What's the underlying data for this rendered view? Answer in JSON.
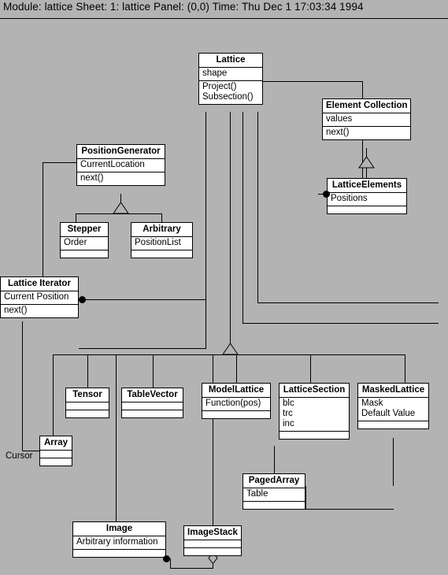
{
  "header": {
    "text": "Module: lattice  Sheet: 1: lattice  Panel: (0,0)  Time: Thu Dec  1 17:03:34 1994",
    "module_label": "Module:",
    "module_value": "lattice",
    "sheet_label": "Sheet:",
    "sheet_value": "1: lattice",
    "panel_label": "Panel:",
    "panel_value": "(0,0)",
    "time_label": "Time:",
    "time_value": "Thu Dec  1 17:03:34 1994"
  },
  "colors": {
    "background": "#b3b3b3",
    "box_fill": "#ffffff",
    "line": "#000000",
    "text": "#000000"
  },
  "classes": {
    "lattice": {
      "name": "Lattice",
      "attributes": "shape",
      "operations": "Project()\nSubsection()"
    },
    "element_collection": {
      "name": "Element Collection",
      "attributes": "values",
      "operations": "next()"
    },
    "lattice_elements": {
      "name": "LatticeElements",
      "attributes": "Positions",
      "operations": ""
    },
    "position_generator": {
      "name": "PositionGenerator",
      "attributes": "CurrentLocation",
      "operations": "next()"
    },
    "stepper": {
      "name": "Stepper",
      "attributes": "Order",
      "operations": ""
    },
    "arbitrary": {
      "name": "Arbitrary",
      "attributes": "PositionList",
      "operations": ""
    },
    "lattice_iterator": {
      "name": "Lattice Iterator",
      "attributes": "Current Position",
      "operations": "next()"
    },
    "tensor": {
      "name": "Tensor",
      "attributes": "",
      "operations": ""
    },
    "table_vector": {
      "name": "TableVector",
      "attributes": "",
      "operations": ""
    },
    "model_lattice": {
      "name": "ModelLattice",
      "attributes": "Function(pos)",
      "operations": ""
    },
    "lattice_section": {
      "name": "LatticeSection",
      "attributes": "blc\ntrc\ninc",
      "operations": ""
    },
    "masked_lattice": {
      "name": "MaskedLattice",
      "attributes": "Mask\nDefault Value",
      "operations": ""
    },
    "array": {
      "name": "Array",
      "attributes": "",
      "operations": ""
    },
    "paged_array": {
      "name": "PagedArray",
      "attributes": "Table",
      "operations": ""
    },
    "image": {
      "name": "Image",
      "attributes": "Arbitrary information",
      "operations": ""
    },
    "image_stack": {
      "name": "ImageStack",
      "attributes": "",
      "operations": ""
    }
  },
  "labels": {
    "cursor": "Cursor"
  }
}
